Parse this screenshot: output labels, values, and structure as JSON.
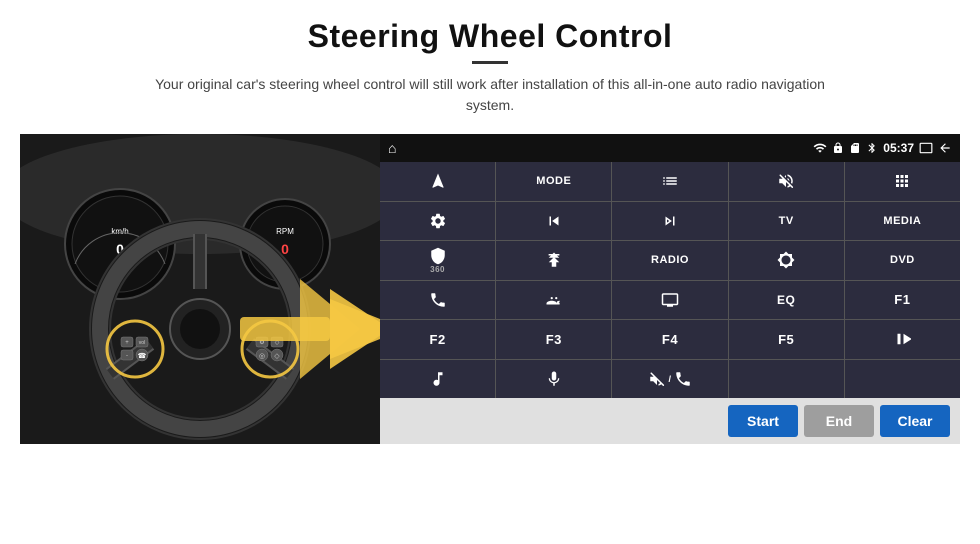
{
  "header": {
    "title": "Steering Wheel Control",
    "subtitle": "Your original car's steering wheel control will still work after installation of this all-in-one auto radio navigation system."
  },
  "status_bar": {
    "time": "05:37",
    "home_icon": "⌂",
    "back_icon": "↩",
    "wifi_icon": "wifi",
    "battery_icon": "battery",
    "volume_icon": "vol"
  },
  "buttons": [
    {
      "icon": "navigate",
      "label": "",
      "row": 1,
      "col": 1
    },
    {
      "icon": "",
      "label": "MODE",
      "row": 1,
      "col": 2
    },
    {
      "icon": "list",
      "label": "",
      "row": 1,
      "col": 3
    },
    {
      "icon": "mute",
      "label": "",
      "row": 1,
      "col": 4
    },
    {
      "icon": "apps",
      "label": "",
      "row": 1,
      "col": 5
    },
    {
      "icon": "settings",
      "label": "",
      "row": 2,
      "col": 1
    },
    {
      "icon": "prev",
      "label": "",
      "row": 2,
      "col": 2
    },
    {
      "icon": "next",
      "label": "",
      "row": 2,
      "col": 3
    },
    {
      "icon": "",
      "label": "TV",
      "row": 2,
      "col": 4
    },
    {
      "icon": "",
      "label": "MEDIA",
      "row": 2,
      "col": 5
    },
    {
      "icon": "camera360",
      "label": "",
      "row": 3,
      "col": 1
    },
    {
      "icon": "eject",
      "label": "",
      "row": 3,
      "col": 2
    },
    {
      "icon": "",
      "label": "RADIO",
      "row": 3,
      "col": 3
    },
    {
      "icon": "brightness",
      "label": "",
      "row": 3,
      "col": 4
    },
    {
      "icon": "",
      "label": "DVD",
      "row": 3,
      "col": 5
    },
    {
      "icon": "phone",
      "label": "",
      "row": 4,
      "col": 1
    },
    {
      "icon": "swipe",
      "label": "",
      "row": 4,
      "col": 2
    },
    {
      "icon": "screen",
      "label": "",
      "row": 4,
      "col": 3
    },
    {
      "icon": "",
      "label": "EQ",
      "row": 4,
      "col": 4
    },
    {
      "icon": "",
      "label": "F1",
      "row": 4,
      "col": 5
    },
    {
      "icon": "",
      "label": "F2",
      "row": 5,
      "col": 1
    },
    {
      "icon": "",
      "label": "F3",
      "row": 5,
      "col": 2
    },
    {
      "icon": "",
      "label": "F4",
      "row": 5,
      "col": 3
    },
    {
      "icon": "",
      "label": "F5",
      "row": 5,
      "col": 4
    },
    {
      "icon": "play-pause",
      "label": "",
      "row": 5,
      "col": 5
    },
    {
      "icon": "music",
      "label": "",
      "row": 6,
      "col": 1
    },
    {
      "icon": "mic",
      "label": "",
      "row": 6,
      "col": 2
    },
    {
      "icon": "vol-phone",
      "label": "",
      "row": 6,
      "col": 3
    },
    {
      "icon": "",
      "label": "",
      "row": 6,
      "col": 4
    },
    {
      "icon": "",
      "label": "",
      "row": 6,
      "col": 5
    }
  ],
  "bottom_bar": {
    "start_label": "Start",
    "end_label": "End",
    "clear_label": "Clear"
  }
}
